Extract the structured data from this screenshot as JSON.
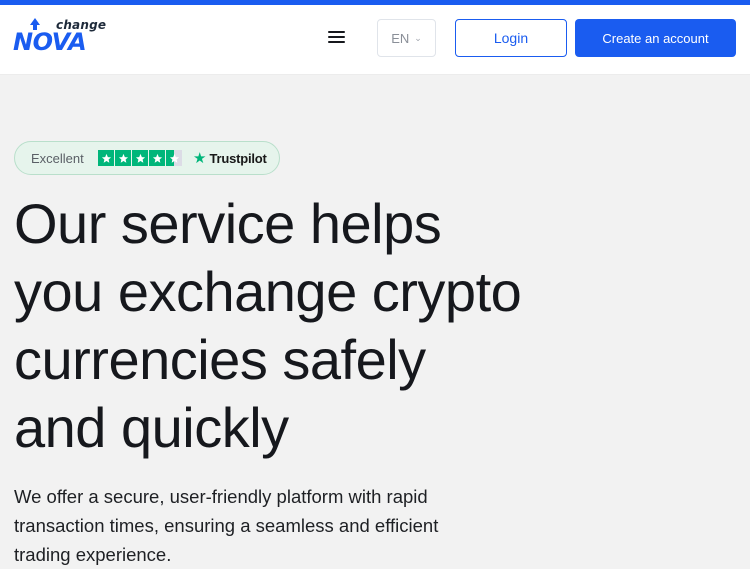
{
  "header": {
    "logo": {
      "small_text": "change",
      "main_text": "NOVA"
    },
    "language": {
      "selected": "EN"
    },
    "login_label": "Login",
    "create_account_label": "Create an account"
  },
  "trustpilot": {
    "label": "Excellent",
    "rating_stars": 4.5,
    "brand": "Trustpilot"
  },
  "hero": {
    "title_lines": [
      "Our service helps",
      "you exchange crypto",
      "currencies safely",
      "and quickly"
    ],
    "subtitle_lines": [
      "We offer a secure, user-friendly platform with rapid",
      "transaction times, ensuring a seamless and efficient",
      "trading experience."
    ]
  },
  "colors": {
    "accent": "#1a5cf0",
    "trustpilot_green": "#00b67a",
    "badge_bg": "#e6f4ec",
    "page_bg": "#f2f2f2"
  },
  "icons": [
    "menu-icon",
    "chevron-down-icon",
    "star-icon",
    "trustpilot-star-icon",
    "logo-arrow-icon"
  ]
}
